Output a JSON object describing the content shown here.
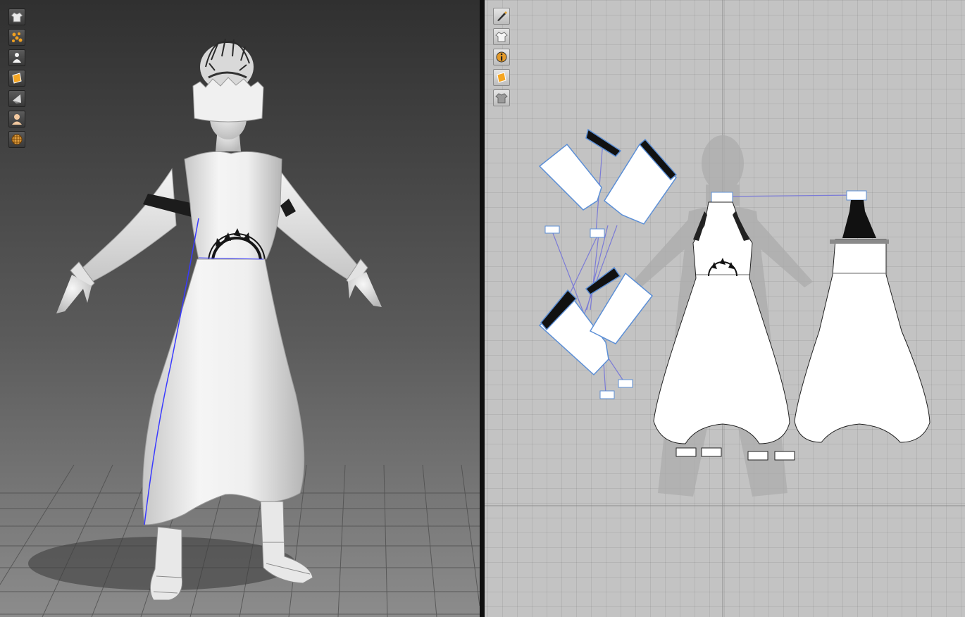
{
  "viewport_3d": {
    "toolbar": [
      {
        "name": "garment-display-icon"
      },
      {
        "name": "particle-display-icon"
      },
      {
        "name": "avatar-display-icon"
      },
      {
        "name": "fabric-texture-icon"
      },
      {
        "name": "pattern-solid-icon"
      },
      {
        "name": "avatar-skin-icon"
      },
      {
        "name": "grid-display-icon"
      }
    ],
    "colors": {
      "background_top": "#303030",
      "background_bottom": "#8c8c8c",
      "garment": "#f2f2f2",
      "trim": "#1a1a1a",
      "seam_line": "#3a3aff"
    }
  },
  "viewport_2d": {
    "toolbar": [
      {
        "name": "pattern-edit-icon"
      },
      {
        "name": "garment-visibility-icon"
      },
      {
        "name": "info-icon"
      },
      {
        "name": "fabric-texture-icon"
      },
      {
        "name": "garment-lock-icon"
      }
    ],
    "colors": {
      "background": "#c3c3c3",
      "pattern_fill": "#ffffff",
      "pattern_outline": "#5c8fd6",
      "sewing_line": "#7b7bd6",
      "axis_line": "#888888"
    }
  }
}
